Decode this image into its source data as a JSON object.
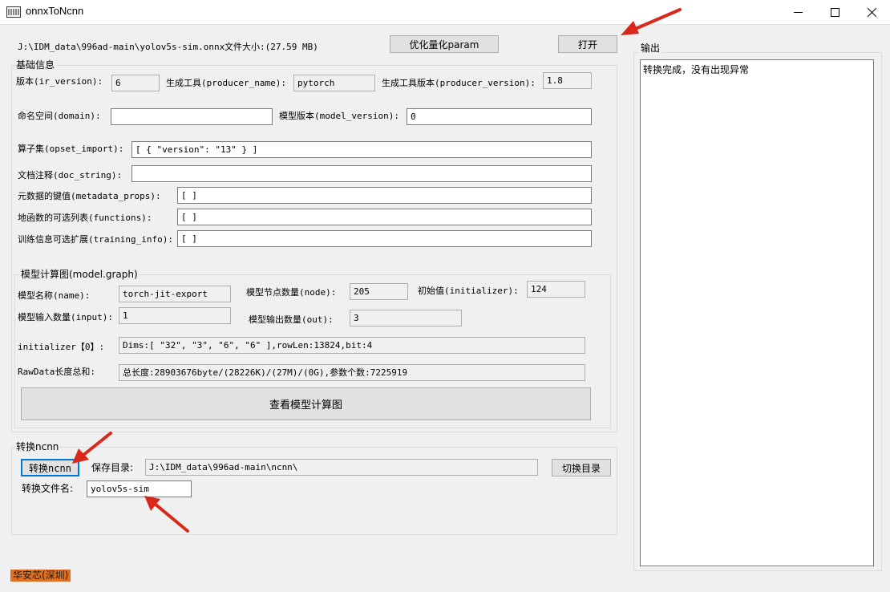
{
  "window": {
    "title": "onnxToNcnn"
  },
  "top": {
    "file_path": "J:\\IDM_data\\996ad-main\\yolov5s-sim.onnx",
    "file_size": "文件大小:(27.59 MB)",
    "optimize_button": "优化量化param",
    "open_button": "打开"
  },
  "basic": {
    "legend": "基础信息",
    "ir_version_label": "版本(ir_version):",
    "ir_version_value": "6",
    "producer_name_label": "生成工具(producer_name):",
    "producer_name_value": "pytorch",
    "producer_version_label": "生成工具版本(producer_version):",
    "producer_version_value": "1.8",
    "domain_label": "命名空间(domain):",
    "domain_value": "",
    "model_version_label": "模型版本(model_version):",
    "model_version_value": "0",
    "opset_label": "算子集(opset_import):",
    "opset_value": "[ { \"version\": \"13\" } ]",
    "doc_string_label": "文档注释(doc_string):",
    "doc_string_value": "",
    "metadata_label": "元数据的键值(metadata_props):",
    "metadata_value": "[ ]",
    "functions_label": "地函数的可选列表(functions):",
    "functions_value": "[ ]",
    "training_label": "训练信息可选扩展(training_info):",
    "training_value": "[ ]"
  },
  "graph": {
    "legend": "模型计算图(model.graph)",
    "name_label": "模型名称(name):",
    "name_value": "torch-jit-export",
    "node_label": "模型节点数量(node):",
    "node_value": "205",
    "initializer_label": "初始值(initializer):",
    "initializer_value": "124",
    "input_label": "模型输入数量(input):",
    "input_value": "1",
    "output_label": "模型输出数量(out):",
    "output_value": "3",
    "init0_label": "initializer【0】:",
    "init0_value": "Dims:[ \"32\", \"3\", \"6\", \"6\" ],rowLen:13824,bit:4",
    "rawdata_label": "RawData长度总和:",
    "rawdata_value": "总长度:28903676byte/(28226K)/(27M)/(0G),参数个数:7225919",
    "view_button": "查看模型计算图"
  },
  "convert": {
    "legend": "转换ncnn",
    "convert_button": "转换ncnn",
    "save_dir_label": "保存目录:",
    "save_dir_value": "J:\\IDM_data\\996ad-main\\ncnn\\",
    "switch_dir_button": "切换目录",
    "filename_label": "转换文件名:",
    "filename_value": "yolov5s-sim"
  },
  "output": {
    "legend": "输出",
    "text": "转换完成，没有出现异常"
  },
  "footer": {
    "company": "华安芯(深圳)"
  },
  "icons": {
    "app": "app-icon",
    "minimize": "minimize-icon",
    "maximize": "maximize-icon",
    "close": "close-icon",
    "annotation": "red-arrow-icon"
  },
  "colors": {
    "focus_border": "#0078d7",
    "annotation_arrow": "#d9281c",
    "badge": "#e07020"
  }
}
